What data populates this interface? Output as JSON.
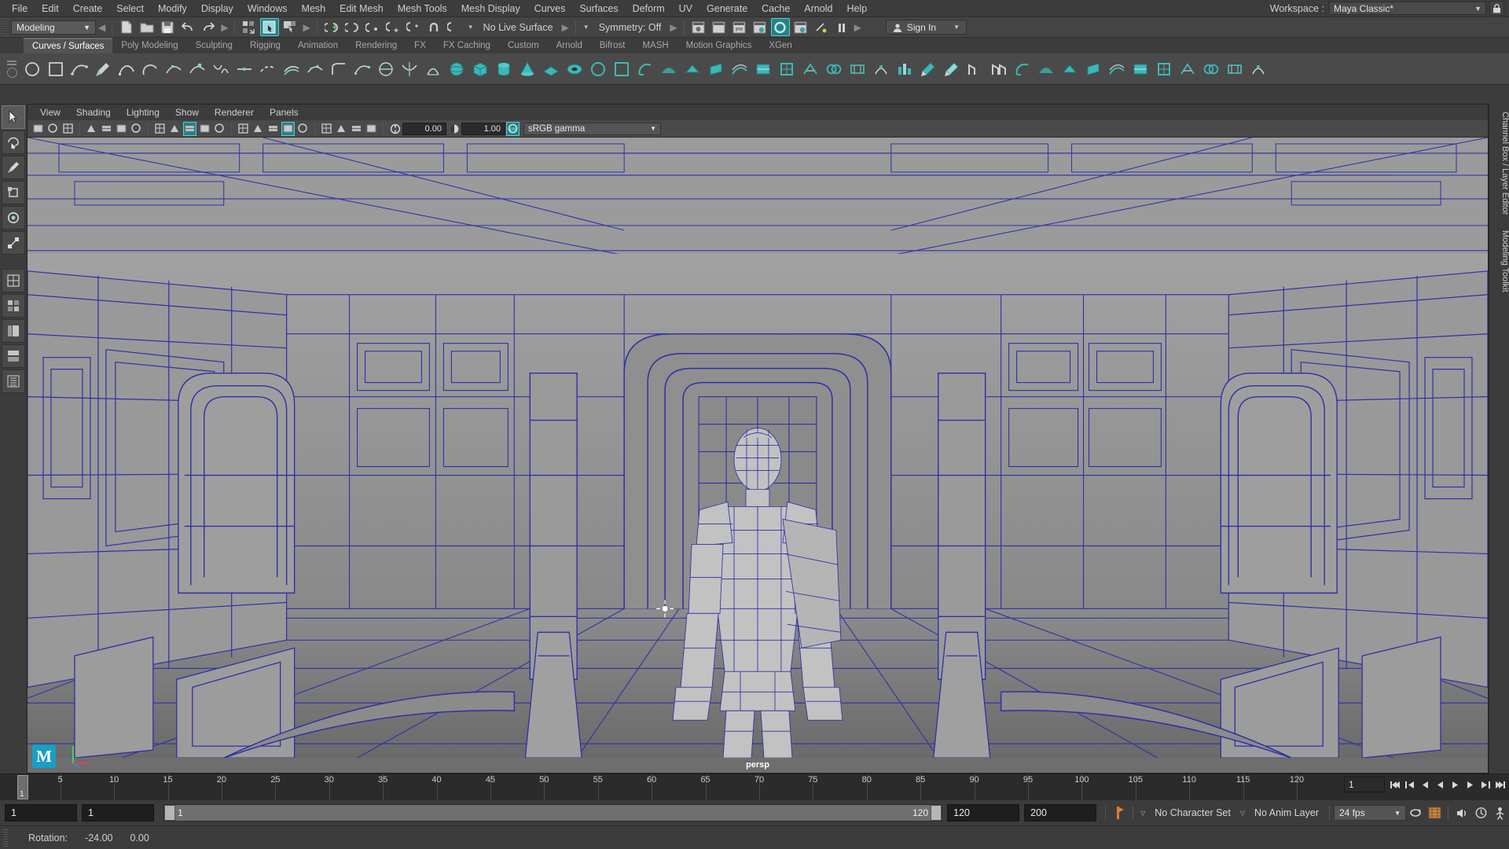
{
  "menubar": {
    "items": [
      "File",
      "Edit",
      "Create",
      "Select",
      "Modify",
      "Display",
      "Windows",
      "Mesh",
      "Edit Mesh",
      "Mesh Tools",
      "Mesh Display",
      "Curves",
      "Surfaces",
      "Deform",
      "UV",
      "Generate",
      "Cache",
      "Arnold",
      "Help"
    ],
    "workspace_label": "Workspace :",
    "workspace_value": "Maya Classic*",
    "lock_icon": "lock-icon"
  },
  "statusbar": {
    "menuset": "Modeling",
    "live_surface": "No Live Surface",
    "symmetry": "Symmetry: Off",
    "sign_in": "Sign In",
    "icons": [
      "new-scene-icon",
      "open-scene-icon",
      "save-scene-icon",
      "undo-icon",
      "redo-icon",
      "select-hierarchy-icon",
      "select-object-icon",
      "select-component-icon",
      "snap-grid-icon",
      "snap-curve-icon",
      "snap-point-icon",
      "snap-projected-icon",
      "snap-view-plane-icon",
      "magnet-icon",
      "make-live-icon",
      "show-render-view-icon",
      "render-current-frame-icon",
      "ipr-render-icon",
      "render-settings-icon",
      "hypershade-icon",
      "render-setup-icon",
      "light-editor-icon",
      "pause-icon"
    ]
  },
  "shelf": {
    "tabs": [
      "Curves / Surfaces",
      "Poly Modeling",
      "Sculpting",
      "Rigging",
      "Animation",
      "Rendering",
      "FX",
      "FX Caching",
      "Custom",
      "Arnold",
      "Bifrost",
      "MASH",
      "Motion Graphics",
      "XGen"
    ],
    "active_tab": "Curves / Surfaces",
    "icon_names": [
      "nurbs-circle-icon",
      "nurbs-square-icon",
      "ep-curve-icon",
      "pencil-curve-icon",
      "bezier-curve-icon",
      "arc-curve-icon",
      "curve-edit-icon",
      "add-points-icon",
      "attach-curve-icon",
      "detach-curve-icon",
      "extend-curve-icon",
      "offset-curve-icon",
      "rebuild-curve-icon",
      "fillet-curve-icon",
      "cv-curve-icon",
      "project-curve-icon",
      "intersect-curve-icon",
      "duplicate-surface-curves-icon",
      "nurbs-sphere-icon",
      "nurbs-cube-icon",
      "nurbs-cylinder-icon",
      "nurbs-cone-icon",
      "nurbs-plane-icon",
      "nurbs-torus-icon",
      "nurbs-circle2-icon",
      "nurbs-square2-icon",
      "revolve-icon",
      "loft-icon",
      "planar-icon",
      "extrude-icon",
      "birail-icon",
      "boundary-icon",
      "square-surface-icon",
      "bevel-icon",
      "bevel-plus-icon",
      "intersect-surfaces-icon",
      "project-curve-surface-icon",
      "trim-tool-icon",
      "untrim-icon",
      "booleans-icon",
      "attach-surfaces-icon",
      "detach-surfaces-icon",
      "align-surfaces-icon",
      "open-close-surfaces-icon",
      "move-seam-icon",
      "insert-isoparms-icon",
      "extend-surfaces-icon",
      "offset-surfaces-icon",
      "round-tool-icon",
      "surface-fillet-icon",
      "stitch-icon",
      "sculpt-geometry-icon",
      "surface-editing-icon"
    ]
  },
  "tools": {
    "left_column": [
      "select-tool-icon",
      "lasso-select-icon",
      "paint-select-icon",
      "move-tool-icon",
      "rotate-tool-icon",
      "scale-tool-icon",
      "last-tool-icon",
      "show-manip-icon",
      "quick-layout-single-icon",
      "quick-layout-four-icon",
      "quick-layout-outliner-icon",
      "quick-layout-persp-graph-icon",
      "quick-layout-hypershade-icon",
      "quick-layout-persp-outliner-icon"
    ]
  },
  "viewport": {
    "panel_menus": [
      "View",
      "Shading",
      "Lighting",
      "Show",
      "Renderer",
      "Panels"
    ],
    "exposure_value": "0.00",
    "gamma_value": "1.00",
    "color_management": "sRGB gamma",
    "camera_label": "persp",
    "logo_text": "M",
    "toolbar_icons": [
      "select-camera-icon",
      "lock-camera-icon",
      "camera-attributes-icon",
      "bookmark-icon",
      "image-plane-icon",
      "two-d-pan-zoom-icon",
      "grid-toggle-icon",
      "film-gate-icon",
      "resolution-gate-icon",
      "gate-mask-icon",
      "xray-icon",
      "xray-joints-icon",
      "wireframe-on-shaded-icon",
      "smooth-shade-icon",
      "textured-icon",
      "light-shading-icon",
      "shadows-icon",
      "screen-space-ao-icon",
      "motion-blur-icon",
      "multisample-icon",
      "depth-of-field-icon",
      "exposure-icon",
      "gamma-icon",
      "color-management-toggle-icon"
    ],
    "scene_description": "Sci-fi corridor interior with armored humanoid character, displayed in wireframe-on-shaded mode"
  },
  "right_tabs": [
    "Channel Box / Layer Editor",
    "Modeling Toolkit"
  ],
  "timeline": {
    "ticks": [
      5,
      10,
      15,
      20,
      25,
      30,
      35,
      40,
      45,
      50,
      55,
      60,
      65,
      70,
      75,
      80,
      85,
      90,
      95,
      100,
      105,
      110,
      115,
      120
    ],
    "current_frame": "1",
    "range_start": 1,
    "range_end": 120,
    "playback_field": "1",
    "playback_buttons": [
      "go-to-start-icon",
      "step-back-frame-icon",
      "step-back-key-icon",
      "play-backwards-icon",
      "play-forwards-icon",
      "step-forward-key-icon",
      "step-forward-frame-icon",
      "go-to-end-icon"
    ]
  },
  "rangebar": {
    "anim_start": "1",
    "range_start": "1",
    "slider_start": "1",
    "slider_end": "120",
    "range_end": "120",
    "anim_end": "200",
    "auto_key_icon": "auto-keyframe-icon",
    "character_set": "No Character Set",
    "anim_layer": "No Anim Layer",
    "fps": "24 fps",
    "right_icons": [
      "cycle-icon",
      "animation-preferences-icon",
      "audio-icon",
      "playback-options-icon",
      "character-icon"
    ]
  },
  "helpline": {
    "label": "Rotation:",
    "value1": "-24.00",
    "value2": "0.00"
  },
  "colors": {
    "accent_teal": "#2e7d80",
    "wire_blue": "#3a3ab8",
    "panel_bg": "#3c3c3c",
    "toolbar_bg": "#444444",
    "viewport_grey": "#8e8e8e",
    "autokey_orange": "#e07a2f"
  }
}
